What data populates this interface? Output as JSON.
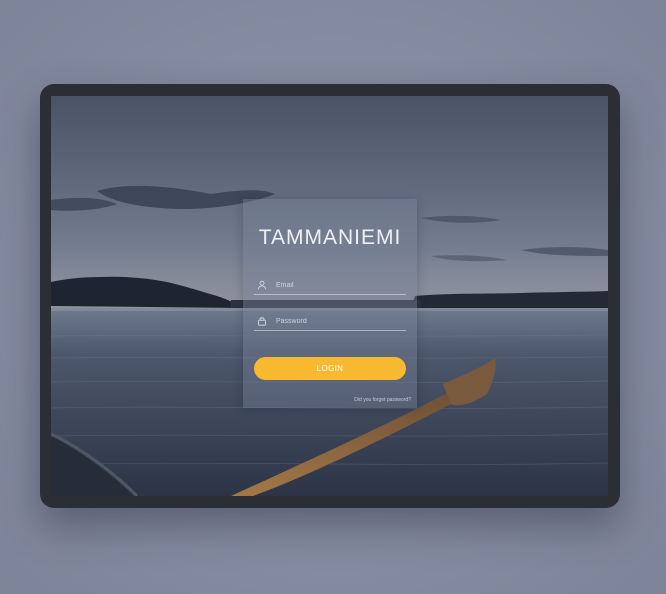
{
  "login": {
    "brand": "TAMMANIEMI",
    "email_placeholder": "Email",
    "password_placeholder": "Password",
    "login_label": "LOGIN",
    "forgot_label": "Did you forget password?"
  },
  "icons": {
    "email": "user-icon",
    "password": "lock-icon"
  },
  "colors": {
    "accent": "#F8B830",
    "page_background": "#8A90A5",
    "device_frame": "#2C2E36"
  }
}
